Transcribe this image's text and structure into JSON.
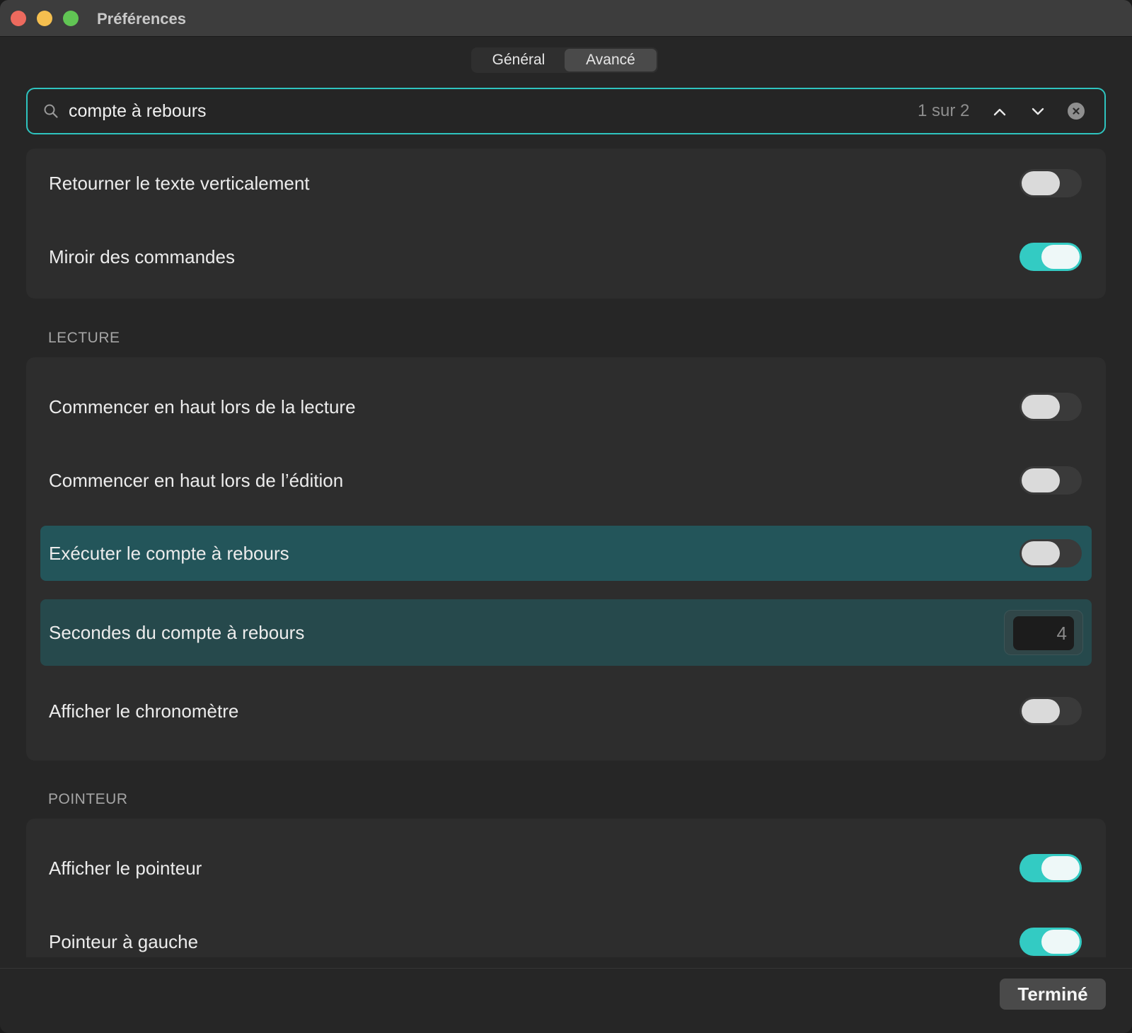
{
  "window": {
    "title": "Préférences"
  },
  "tabs": [
    {
      "label": "Général",
      "active": false
    },
    {
      "label": "Avancé",
      "active": true
    }
  ],
  "search": {
    "value": "compte à rebours",
    "match_count": "1 sur 2"
  },
  "settings_top": [
    {
      "label": "Retourner le texte verticalement",
      "enabled": false
    },
    {
      "label": "Miroir des commandes",
      "enabled": true
    }
  ],
  "lecture": {
    "header": "LECTURE",
    "items": [
      {
        "label": "Commencer en haut lors de la lecture",
        "enabled": false
      },
      {
        "label": "Commencer en haut lors de l’édition",
        "enabled": false
      },
      {
        "label": "Exécuter le compte à rebours",
        "enabled": false
      },
      {
        "label": "Secondes du compte à rebours",
        "value": "4"
      },
      {
        "label": "Afficher le chronomètre",
        "enabled": false
      }
    ]
  },
  "pointeur": {
    "header": "POINTEUR",
    "items": [
      {
        "label": "Afficher le pointeur",
        "enabled": true
      },
      {
        "label": "Pointeur à gauche",
        "enabled": true
      }
    ]
  },
  "footer": {
    "done_label": "Terminé"
  },
  "colors": {
    "accent": "#33cbc3",
    "highlight_match": "#23555a",
    "highlight_secondary": "#26494c"
  }
}
